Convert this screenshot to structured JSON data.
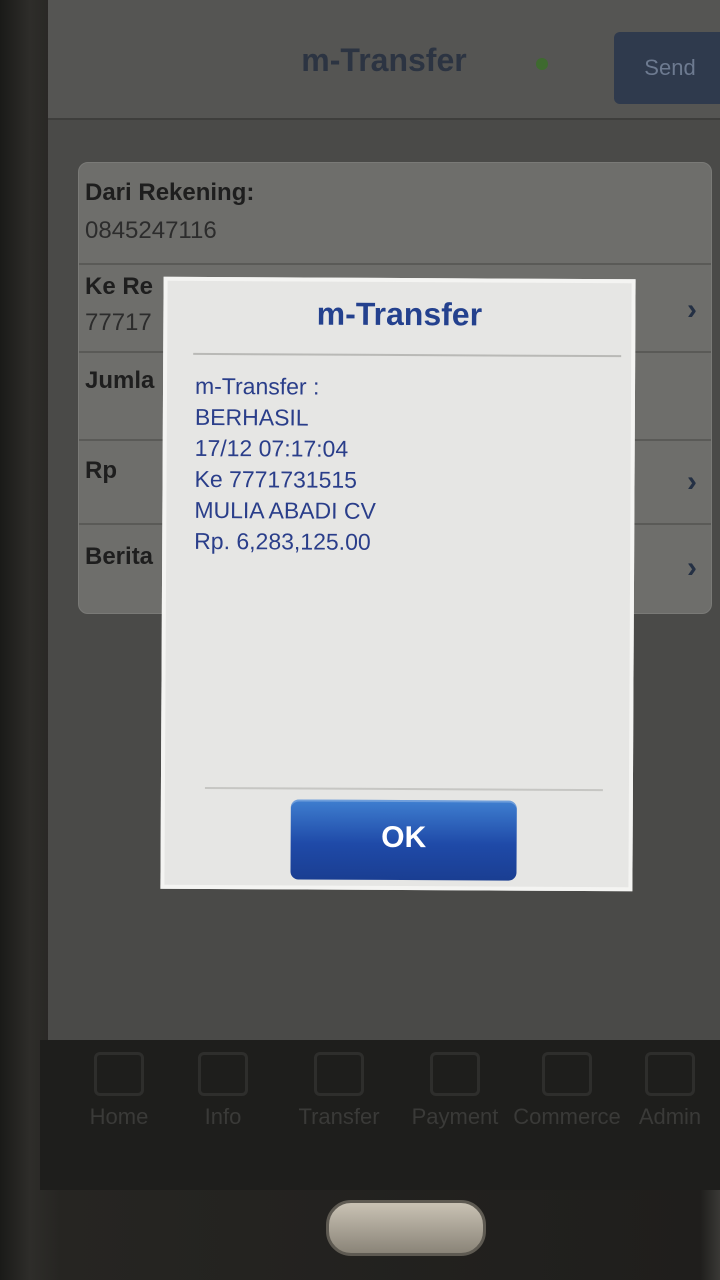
{
  "header": {
    "title": "m-Transfer",
    "send_label": "Send"
  },
  "form": {
    "rows": [
      {
        "label": "Dari Rekening:",
        "value": "0845247116"
      },
      {
        "label": "Ke Re",
        "value": "77717"
      },
      {
        "label": "Jumla",
        "value": ""
      },
      {
        "label": "Rp",
        "value": ""
      },
      {
        "label": "Berita",
        "value": ""
      }
    ]
  },
  "dialog": {
    "title": "m-Transfer",
    "lines": [
      "m-Transfer :",
      "BERHASIL",
      "17/12 07:17:04",
      "Ke 7771731515",
      "MULIA ABADI CV",
      "Rp. 6,283,125.00"
    ],
    "ok_label": "OK"
  },
  "nav": {
    "items": [
      {
        "label": "Home",
        "icon": "home-icon"
      },
      {
        "label": "Info",
        "icon": "info-icon"
      },
      {
        "label": "Transfer",
        "icon": "transfer-icon"
      },
      {
        "label": "Payment",
        "icon": "payment-icon"
      },
      {
        "label": "Commerce",
        "icon": "commerce-icon"
      },
      {
        "label": "Admin",
        "icon": "admin-icon"
      }
    ]
  },
  "colors": {
    "accent": "#24418e",
    "ok_button": "#1f4aa8",
    "header_bg": "#555553"
  }
}
